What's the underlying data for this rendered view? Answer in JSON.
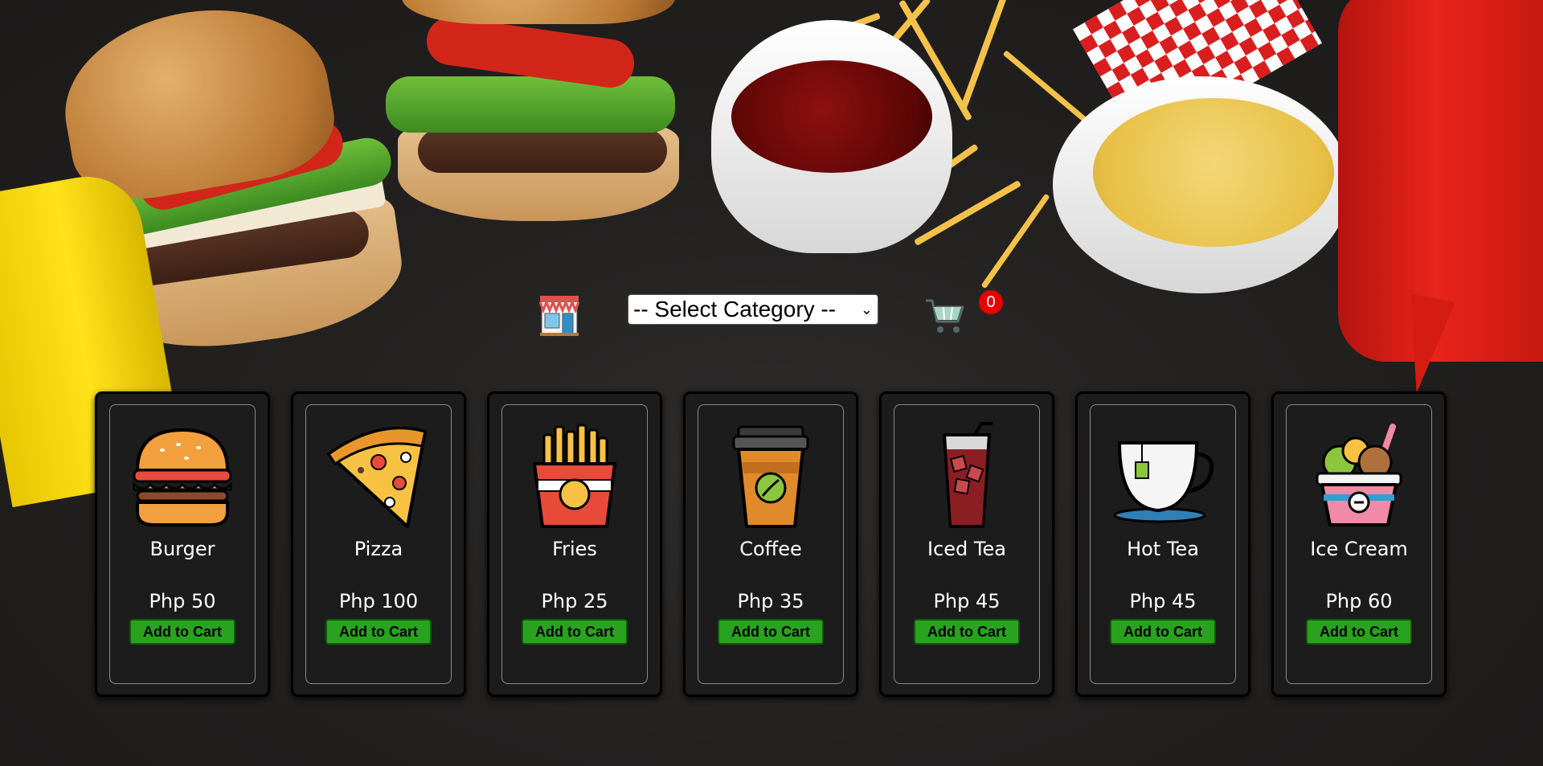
{
  "toolbar": {
    "store_icon": "store-icon",
    "category_select": {
      "selected": "-- Select Category --"
    },
    "cart_icon": "shopping-cart-icon",
    "cart_count": "0"
  },
  "products": [
    {
      "name": "Burger",
      "price": "Php 50",
      "button": "Add to Cart",
      "icon": "burger-icon"
    },
    {
      "name": "Pizza",
      "price": "Php 100",
      "button": "Add to Cart",
      "icon": "pizza-slice-icon"
    },
    {
      "name": "Fries",
      "price": "Php 25",
      "button": "Add to Cart",
      "icon": "fries-icon"
    },
    {
      "name": "Coffee",
      "price": "Php 35",
      "button": "Add to Cart",
      "icon": "coffee-cup-icon"
    },
    {
      "name": "Iced Tea",
      "price": "Php 45",
      "button": "Add to Cart",
      "icon": "iced-tea-glass-icon"
    },
    {
      "name": "Hot Tea",
      "price": "Php 45",
      "button": "Add to Cart",
      "icon": "tea-cup-icon"
    },
    {
      "name": "Ice Cream",
      "price": "Php 60",
      "button": "Add to Cart",
      "icon": "ice-cream-cup-icon"
    }
  ],
  "colors": {
    "button_green": "#28a21f",
    "badge_red": "#e60000",
    "card_bg": "#1d1c1c"
  }
}
